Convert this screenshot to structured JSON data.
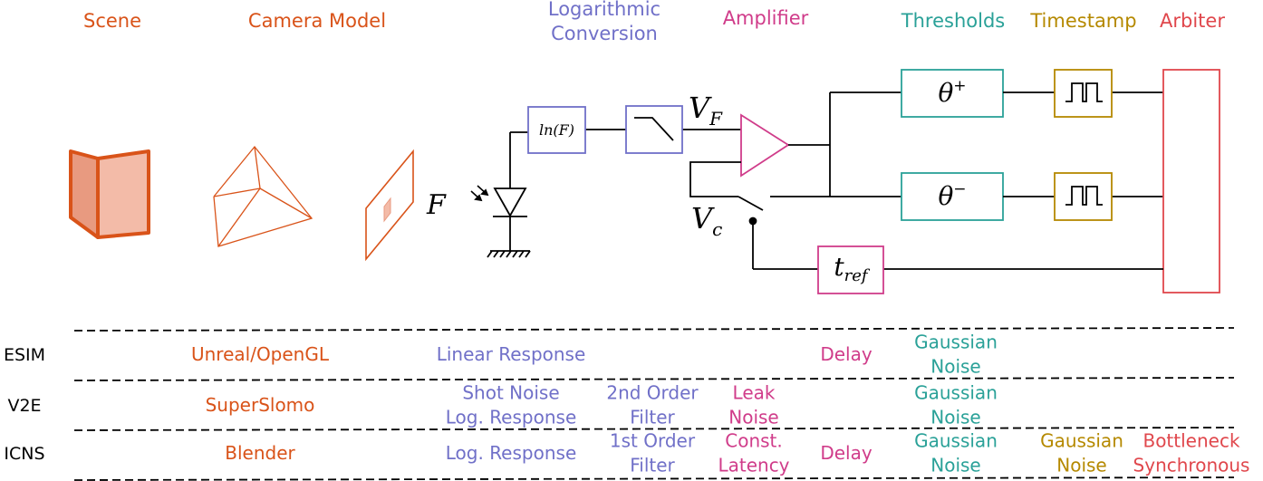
{
  "colors": {
    "scene": "#d95319",
    "log": "#7070c8",
    "amp": "#d03c8a",
    "thr": "#2aa198",
    "ts": "#b58900",
    "arb": "#e0474c",
    "wire": "#000000"
  },
  "stages": {
    "scene": "Scene",
    "camera": "Camera Model",
    "log_line1": "Logarithmic",
    "log_line2": "Conversion",
    "amplifier": "Amplifier",
    "thresholds": "Thresholds",
    "timestamp": "Timestamp",
    "arbiter": "Arbiter"
  },
  "circuit": {
    "flux": "F",
    "ln_block": "ln(F)",
    "vf_base": "V",
    "vf_sub": "F",
    "vc_base": "V",
    "vc_sub": "c",
    "theta_plus_base": "θ",
    "theta_plus_sup": "+",
    "theta_minus_base": "θ",
    "theta_minus_sup": "−",
    "tref_base": "t",
    "tref_sub": "ref",
    "icons": [
      "scene-cube-icon",
      "camera-frustum-icon",
      "image-plane-icon",
      "photodiode-icon",
      "ground-icon",
      "lowpass-filter-icon",
      "amplifier-triangle-icon",
      "switch-icon",
      "pulse-icon"
    ]
  },
  "table": {
    "rows": [
      {
        "name": "ESIM",
        "scene": [
          "Unreal/OpenGL"
        ],
        "log": [
          "Linear Response"
        ],
        "filter": [],
        "amp": [],
        "delay": [
          "Delay"
        ],
        "thr": [
          "Gaussian",
          "Noise"
        ],
        "ts": [],
        "arb": []
      },
      {
        "name": "V2E",
        "scene": [
          "SuperSlomo"
        ],
        "log": [
          "Shot Noise",
          "Log. Response"
        ],
        "filter": [
          "2nd Order",
          "Filter"
        ],
        "amp": [
          "Leak",
          "Noise"
        ],
        "delay": [],
        "thr": [
          "Gaussian",
          "Noise"
        ],
        "ts": [],
        "arb": []
      },
      {
        "name": "ICNS",
        "scene": [
          "Blender"
        ],
        "log": [
          "Log. Response"
        ],
        "filter": [
          "1st Order",
          "Filter"
        ],
        "amp": [
          "Const.",
          "Latency"
        ],
        "delay": [
          "Delay"
        ],
        "thr": [
          "Gaussian",
          "Noise"
        ],
        "ts": [
          "Gaussian",
          "Noise"
        ],
        "arb": [
          "Bottleneck",
          "Synchronous"
        ]
      }
    ]
  }
}
